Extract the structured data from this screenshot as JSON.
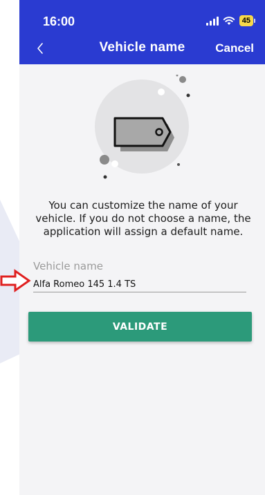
{
  "status_bar": {
    "time": "16:00",
    "battery": "45"
  },
  "header": {
    "title": "Vehicle name",
    "cancel_label": "Cancel",
    "back_icon": "chevron-left-icon"
  },
  "description": "You can customize the name of your vehicle. If you do not choose a name, the application will assign a default name.",
  "vehicle_field": {
    "label": "Vehicle name",
    "value": "Alfa Romeo 145 1.4 TS"
  },
  "validate_label": "VALIDATE",
  "colors": {
    "header": "#2a3bd1",
    "validate": "#2c9a7a",
    "arrow": "#e02020"
  }
}
